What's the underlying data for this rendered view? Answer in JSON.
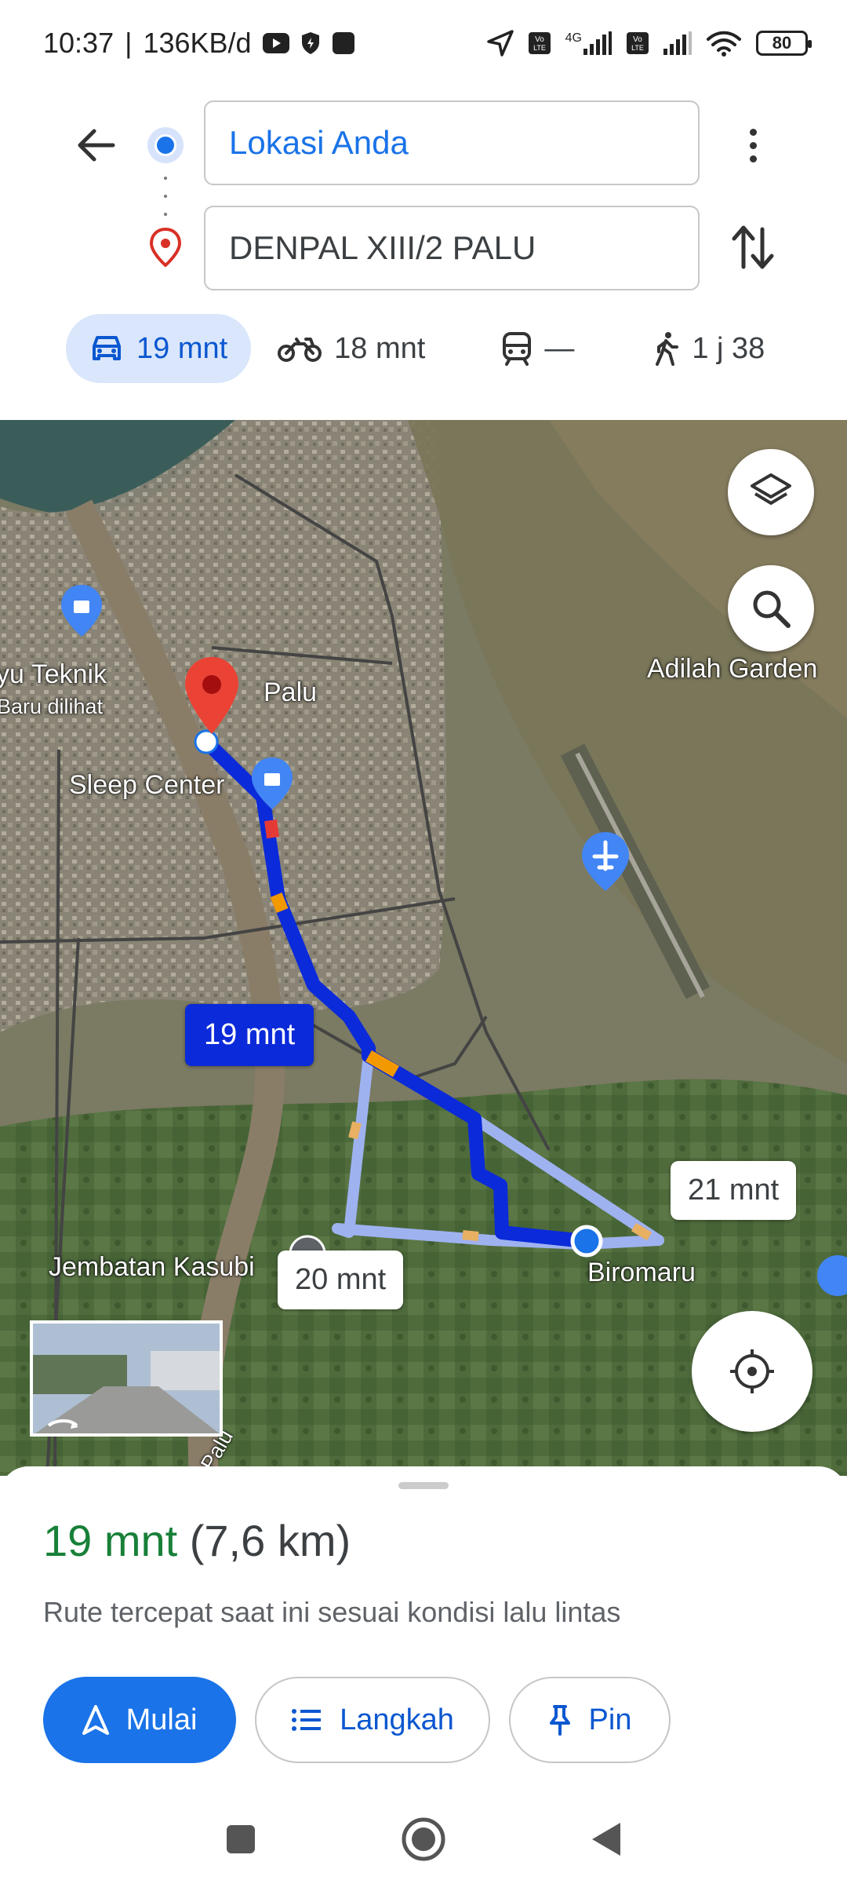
{
  "status_bar": {
    "time": "10:37",
    "data_rate": "136KB/d",
    "network_1": "4G",
    "battery": "80"
  },
  "search": {
    "origin": "Lokasi Anda",
    "destination": "DENPAL XIII/2 PALU"
  },
  "modes": [
    {
      "name": "car",
      "label": "19 mnt"
    },
    {
      "name": "motorcycle",
      "label": "18 mnt"
    },
    {
      "name": "transit",
      "label": "—"
    },
    {
      "name": "walk",
      "label": "1 j 38"
    }
  ],
  "map": {
    "labels": {
      "teknik": "yu Teknik",
      "teknik_sub": "Baru dilihat",
      "palu": "Palu",
      "sleep_center": "Sleep Center",
      "adilah": "Adilah Garden",
      "jembatan": "Jembatan Kasubi",
      "biromaru": "Biromaru",
      "river": "Palu"
    },
    "eta_main": "19 mnt",
    "eta_alt1": "21 mnt",
    "eta_alt2": "20 mnt",
    "route_color": "#0b2ad9",
    "alt_route_color": "#9fb2f0"
  },
  "sheet": {
    "duration": "19 mnt",
    "distance": "(7,6 km)",
    "subtitle": "Rute tercepat saat ini sesuai kondisi lalu lintas",
    "start_label": "Mulai",
    "steps_label": "Langkah",
    "pin_label": "Pin"
  },
  "colors": {
    "accent": "#1a73e8",
    "eta_green": "#188038"
  }
}
